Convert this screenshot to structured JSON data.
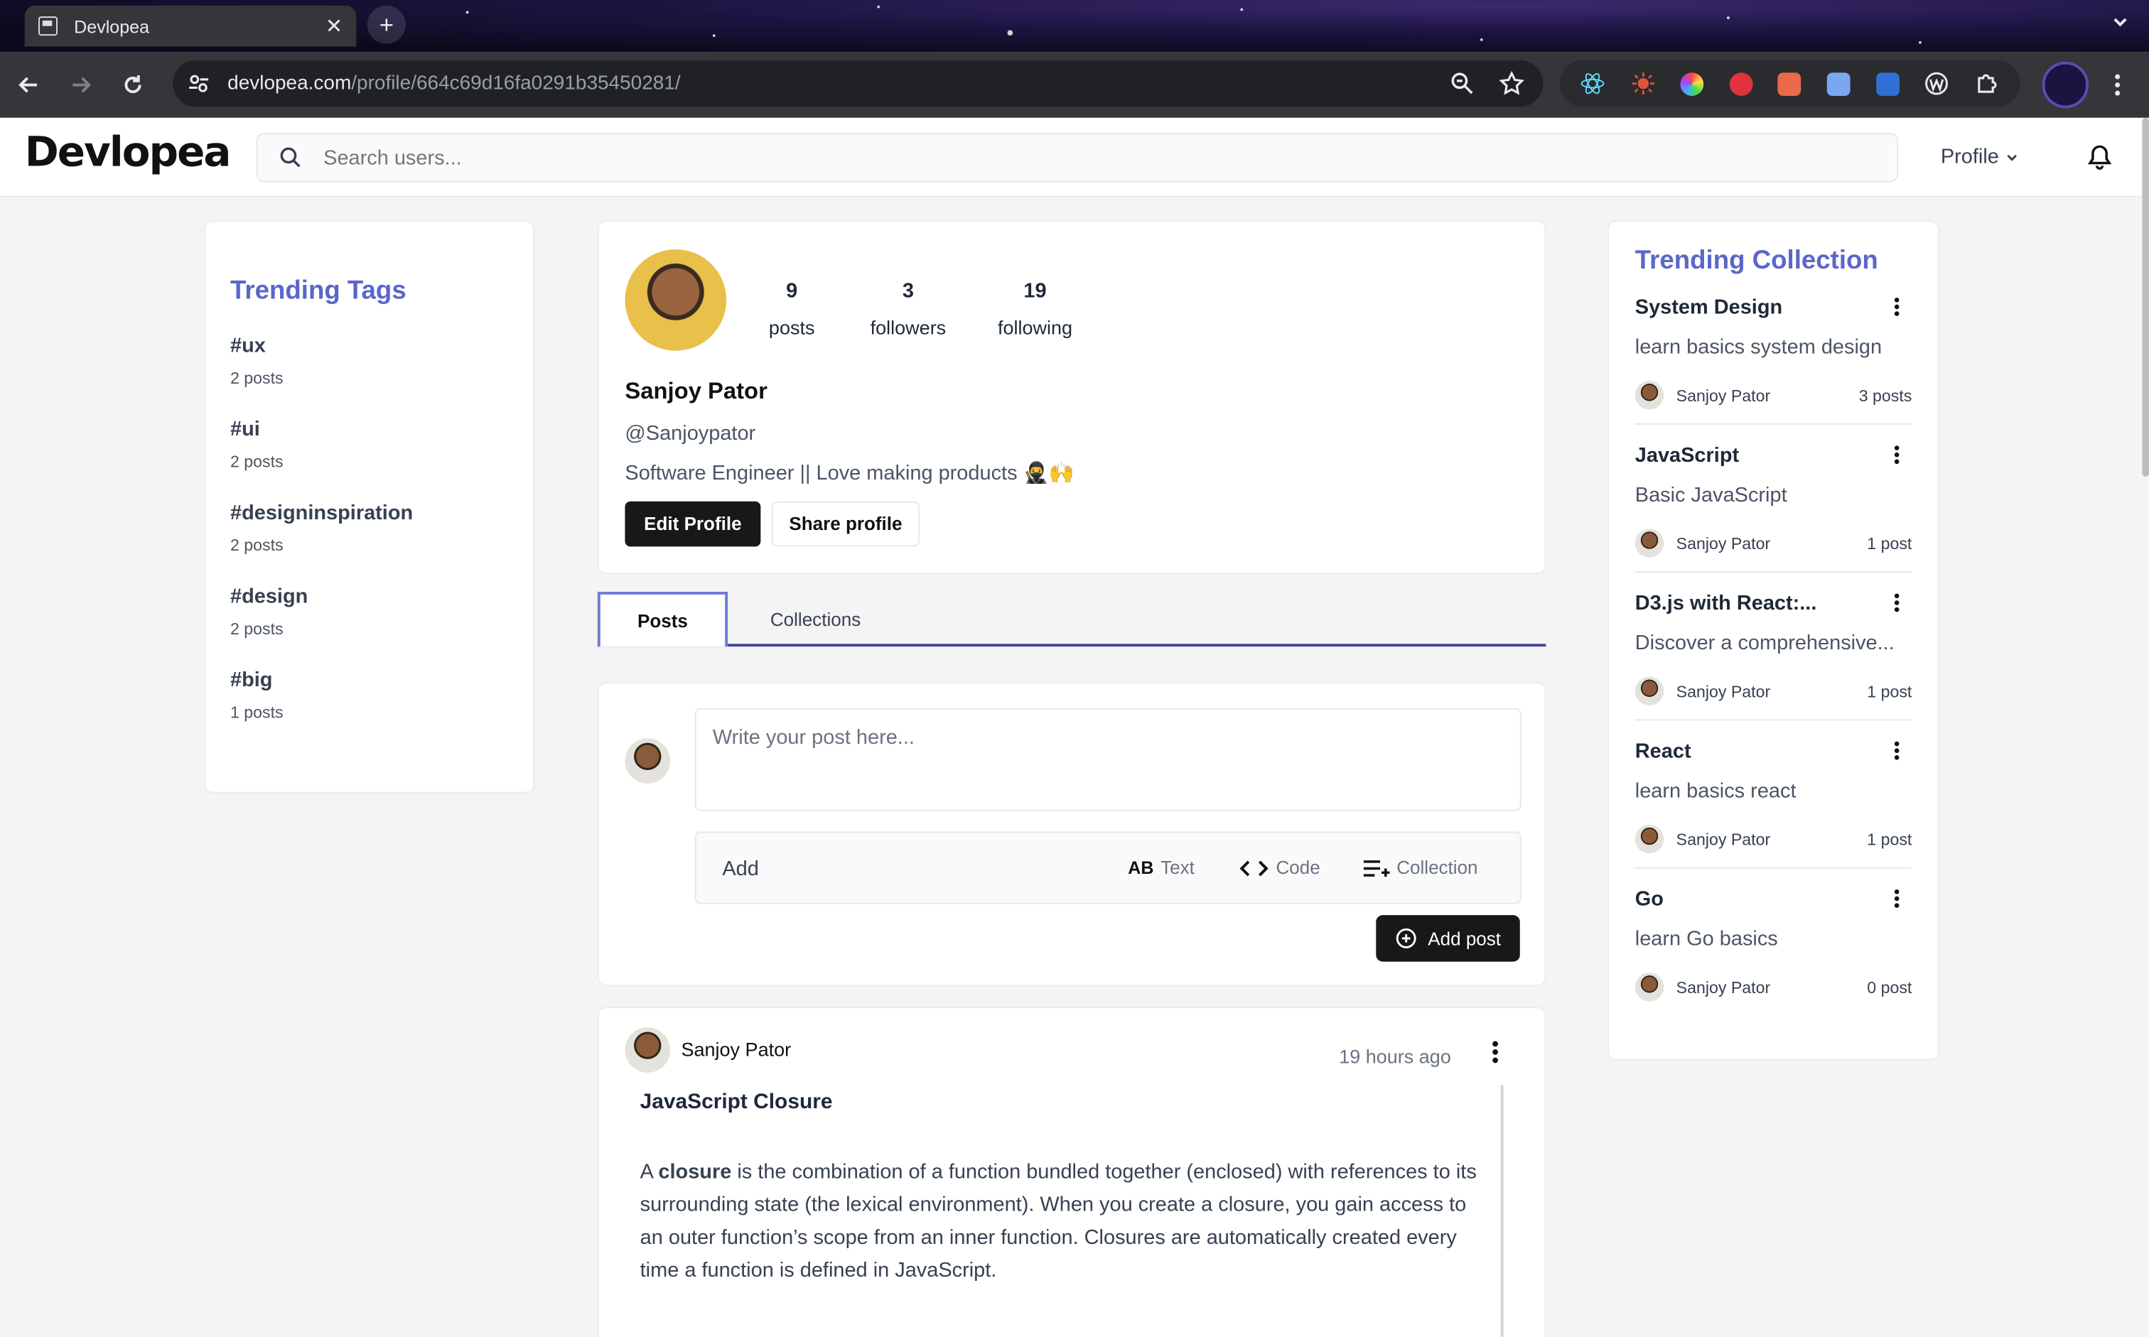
{
  "browser": {
    "tab_title": "Devlopea",
    "url_host": "devlopea.com",
    "url_path": "/profile/664c69d16fa0291b35450281/"
  },
  "app": {
    "logo_text": "Devlopea",
    "search_placeholder": "Search users...",
    "profile_menu": "Profile"
  },
  "trending_tags": {
    "title": "Trending Tags",
    "items": [
      {
        "tag": "#ux",
        "count": "2 posts"
      },
      {
        "tag": "#ui",
        "count": "2 posts"
      },
      {
        "tag": "#designinspiration",
        "count": "2 posts"
      },
      {
        "tag": "#design",
        "count": "2 posts"
      },
      {
        "tag": "#big",
        "count": "1 posts"
      }
    ]
  },
  "profile": {
    "posts_count": "9",
    "posts_label": "posts",
    "followers_count": "3",
    "followers_label": "followers",
    "following_count": "19",
    "following_label": "following",
    "name": "Sanjoy Pator",
    "handle": "@Sanjoypator",
    "bio": "Software Engineer || Love making products 🥷🙌",
    "edit_label": "Edit Profile",
    "share_label": "Share profile"
  },
  "tabs": {
    "posts": "Posts",
    "collections": "Collections"
  },
  "composer": {
    "placeholder": "Write your post here...",
    "add_label": "Add",
    "text_opt": "Text",
    "code_opt": "Code",
    "collection_opt": "Collection",
    "add_post": "Add post"
  },
  "post": {
    "author": "Sanjoy Pator",
    "time": "19 hours ago",
    "title": "JavaScript Closure",
    "body_lead": "A ",
    "body_bold": "closure",
    "body_rest": " is the combination of a function bundled together (enclosed) with references to its surrounding state (the lexical environment). When you create a closure, you gain access to an outer function’s scope from an inner function. Closures are automatically created every time a function is defined in JavaScript."
  },
  "trending_collection": {
    "title": "Trending Collection",
    "items": [
      {
        "name": "System Design",
        "desc": "learn basics system design",
        "author": "Sanjoy Pator",
        "count": "3 posts"
      },
      {
        "name": "JavaScript",
        "desc": "Basic JavaScript",
        "author": "Sanjoy Pator",
        "count": "1 post"
      },
      {
        "name": "D3.js with React:...",
        "desc": "Discover a comprehensive...",
        "author": "Sanjoy Pator",
        "count": "1 post"
      },
      {
        "name": "React",
        "desc": "learn basics react",
        "author": "Sanjoy Pator",
        "count": "1 post"
      },
      {
        "name": "Go",
        "desc": "learn Go basics",
        "author": "Sanjoy Pator",
        "count": "0 post"
      }
    ]
  },
  "colors": {
    "accent": "#5a67c9",
    "dark_button": "#18181b",
    "tab_underline": "#3f4590"
  },
  "icons": [
    "search-icon",
    "bell-icon",
    "chevron-down-icon",
    "kebab-icon",
    "plus-circle-icon",
    "code-icon",
    "text-icon",
    "collection-icon",
    "back-icon",
    "forward-icon",
    "reload-icon",
    "zoom-icon",
    "star-icon"
  ]
}
